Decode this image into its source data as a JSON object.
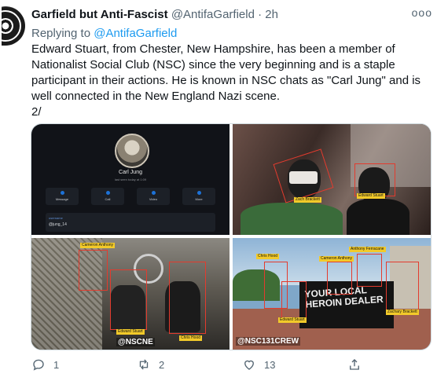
{
  "tweet": {
    "display_name": "Garfield but Anti-Fascist",
    "handle": "@AntifaGarfield",
    "separator": "·",
    "time": "2h",
    "more_glyph": "ooo",
    "replying_prefix": "Replying to",
    "replying_handle": "@AntifaGarfield",
    "text": "Edward Stuart, from Chester, New Hampshire, has been a member of Nationalist Social Club (NSC) since the very beginning and is a staple participant in their actions. He is known in NSC chats as \"Carl Jung\" and is well connected in the New England Nazi scene.\n2/"
  },
  "media": {
    "phone": {
      "contact_name": "Carl Jung",
      "status": "last seen today at 1:09",
      "buttons": [
        "Message",
        "Call",
        "Video",
        "More"
      ],
      "username_label": "username",
      "username_value": "@jung_14"
    },
    "photo2_labels": [
      "Zach Brackett",
      "Edward Stuart"
    ],
    "photo3_labels": [
      "Cameron Anthony",
      "Edward Stuart",
      "Chris Hood"
    ],
    "photo3_watermark": "@NSCNE",
    "photo4_labels": [
      "Chris Hood",
      "Anthony Ferracane",
      "Cameron Anthony",
      "Zachary Brackett",
      "Edward Stuart"
    ],
    "photo4_banner": "YOUR LOCAL HEROIN DEALER",
    "photo4_watermark": "@NSC131CREW"
  },
  "actions": {
    "reply_count": "1",
    "retweet_count": "2",
    "like_count": "13"
  },
  "icons": [
    "reply-icon",
    "retweet-icon",
    "like-icon",
    "share-icon",
    "more-icon"
  ],
  "colors": {
    "accent": "#1d9bf0",
    "label_bg": "#f2ca2a",
    "box_red": "#e33b2e"
  }
}
